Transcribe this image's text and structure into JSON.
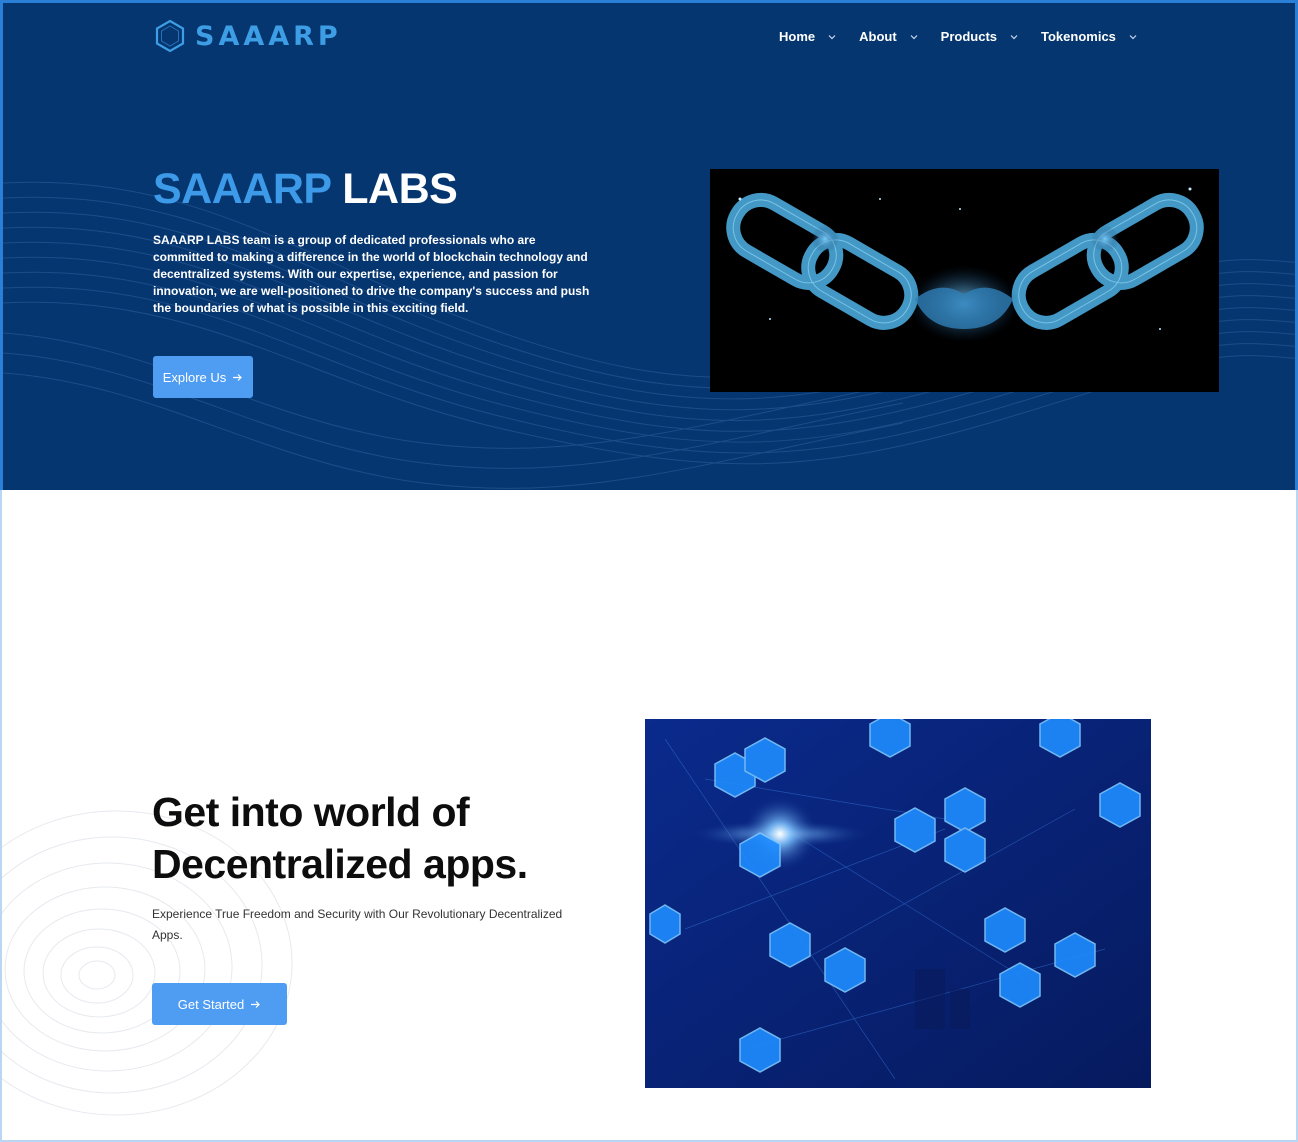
{
  "brand": {
    "name": "SAAARP",
    "icon": "hexagon-logo-icon"
  },
  "nav": {
    "items": [
      {
        "label": "Home"
      },
      {
        "label": "About"
      },
      {
        "label": "Products"
      },
      {
        "label": "Tokenomics"
      }
    ]
  },
  "hero": {
    "title_accent": "SAAARP",
    "title_rest": "LABS",
    "description": "SAAARP LABS team is a group of dedicated professionals who are committed to making a difference in the world of blockchain technology and decentralized systems. With our expertise, experience, and passion for innovation, we are well-positioned to drive the company's success and push the boundaries of what is possible in this exciting field.",
    "button_label": "Explore Us",
    "image": "blockchain-handshake-chain-image"
  },
  "section2": {
    "title_line1": "Get into world of",
    "title_line2_a": "Decentralized",
    "title_line2_b": "apps.",
    "description": "Experience True Freedom and Security with Our Revolutionary Decentralized Apps.",
    "button_label": "Get Started",
    "image": "hexagon-network-apps-image"
  },
  "colors": {
    "hero_bg": "#063670",
    "accent": "#3d9ae8",
    "button": "#4f9cf3",
    "underline": "#f7c948"
  }
}
